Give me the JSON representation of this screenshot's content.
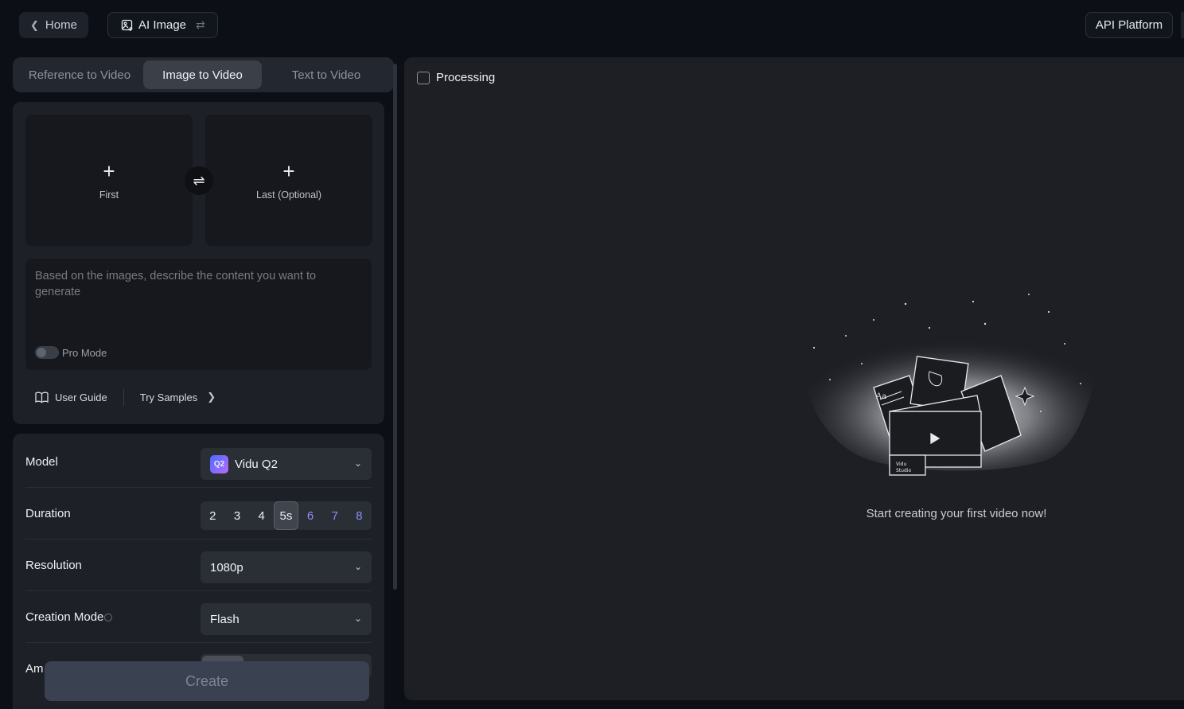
{
  "topbar": {
    "home_label": "Home",
    "ai_image_label": "AI Image",
    "api_label": "API Platform"
  },
  "tabs": [
    "Reference to Video",
    "Image to Video",
    "Text to Video"
  ],
  "active_tab": "Image to Video",
  "upload": {
    "first_label": "First",
    "last_label": "Last (Optional)"
  },
  "prompt": {
    "placeholder": "Based on the images, describe the content you want to generate",
    "pro_mode_label": "Pro Mode",
    "pro_mode_on": false
  },
  "links": {
    "user_guide": "User Guide",
    "try_samples": "Try Samples"
  },
  "settings": {
    "model_label": "Model",
    "model_badge": "Q2",
    "model_value": "Vidu Q2",
    "duration_label": "Duration",
    "durations": [
      "2",
      "3",
      "4",
      "5s",
      "6",
      "7",
      "8"
    ],
    "duration_selected": "5s",
    "resolution_label": "Resolution",
    "resolution_value": "1080p",
    "creation_mode_label": "Creation Mode",
    "creation_mode_value": "Flash",
    "partial_label": "Am"
  },
  "create_label": "Create",
  "main": {
    "processing_label": "Processing",
    "empty_text": "Start creating your first video now!",
    "illus_card_text": "Aa",
    "illus_brand": [
      "Vidu",
      "Studio"
    ]
  },
  "colors": {
    "accent_pro": "#8b8ff5",
    "background": "#0c1016",
    "panel": "#1d2026"
  }
}
